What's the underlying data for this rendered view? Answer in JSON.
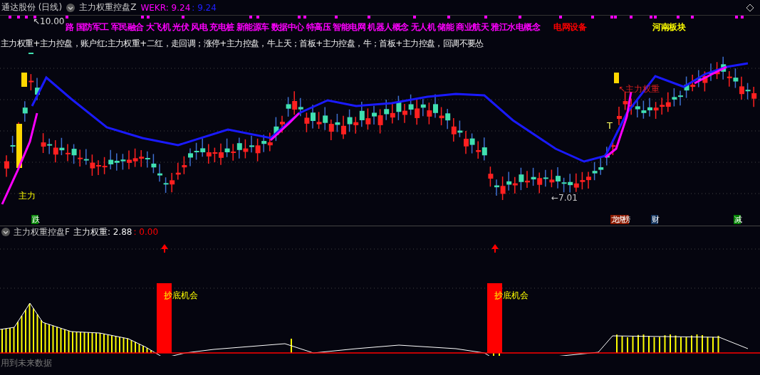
{
  "header": {
    "stock_title": "通达股份 (日线)",
    "indicator": "主力权重控盘Z",
    "value_main": "WEKR: 9.24",
    "value_alt": ": 9.24"
  },
  "concept_tags": [
    {
      "text": "路",
      "color": "#ff00ff"
    },
    {
      "text": "国防军工",
      "color": "#ff00ff"
    },
    {
      "text": "军民融合",
      "color": "#ff00ff"
    },
    {
      "text": "大飞机",
      "color": "#ff00ff"
    },
    {
      "text": "光伏",
      "color": "#ff00ff"
    },
    {
      "text": "风电",
      "color": "#ff00ff"
    },
    {
      "text": "充电桩",
      "color": "#ff00ff"
    },
    {
      "text": "新能源车",
      "color": "#ff00ff"
    },
    {
      "text": "数据中心",
      "color": "#ff00ff"
    },
    {
      "text": "特高压",
      "color": "#ff00ff"
    },
    {
      "text": "智能电网",
      "color": "#ff00ff"
    },
    {
      "text": "机器人概念",
      "color": "#ff00ff"
    },
    {
      "text": "无人机",
      "color": "#ff00ff"
    },
    {
      "text": "储能",
      "color": "#ff00ff"
    },
    {
      "text": "商业航天",
      "color": "#ff00ff"
    },
    {
      "text": "雅江水电概念",
      "color": "#ff00ff"
    },
    {
      "text": "电网设备",
      "color": "#ff0000"
    },
    {
      "text": "河南板块",
      "color": "#ffff00"
    }
  ],
  "description": "主力权重+主力控盘，账户红;主力权重+二红，走回调；涨停+主力控盘，牛上天；首板+主力控盘，牛；首板+主力控盘，回调不要怂",
  "chart_labels": [
    {
      "kind": "high",
      "text": "↖10.00"
    },
    {
      "kind": "signal",
      "text": "主力"
    },
    {
      "kind": "low",
      "text": "←7.01"
    },
    {
      "kind": "weight",
      "text": "↖主力权重"
    },
    {
      "kind": "mark",
      "text": "T"
    }
  ],
  "event_badges": [
    {
      "text": "跌",
      "color": "#008000"
    },
    {
      "text": "龙虎榜",
      "color": "#8b1a00"
    },
    {
      "text": "财",
      "color": "#10305a"
    },
    {
      "text": "减",
      "color": "#008000"
    }
  ],
  "indicator_panel": {
    "title": "主力权重控盘F",
    "value_main": "主力权重: 2.88",
    "value_alt": ": 0.00",
    "signals": [
      {
        "text": "抄底机会"
      },
      {
        "text": "抄底机会"
      }
    ]
  },
  "footer_note": "用到未来数据"
}
